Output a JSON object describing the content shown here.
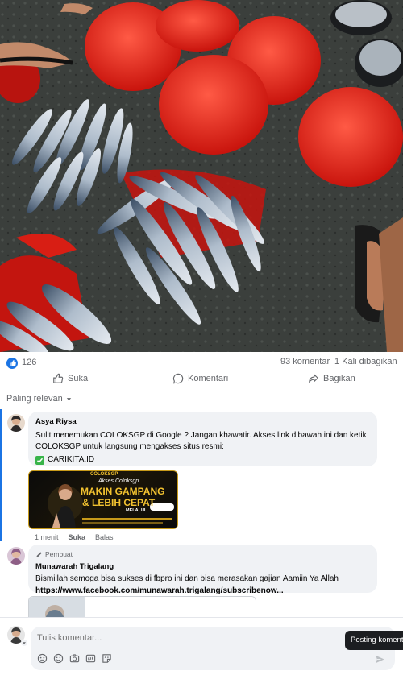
{
  "post": {
    "like_count": "126",
    "comments_count": "93 komentar",
    "shares_count": "1 Kali dibagikan"
  },
  "actions": {
    "like": "Suka",
    "comment": "Komentari",
    "share": "Bagikan"
  },
  "sort": {
    "label": "Paling relevan"
  },
  "comments": [
    {
      "author": "Asya Riysa",
      "text": "Sulit menemukan COLOKSGP di Google ? Jangan khawatir. Akses link dibawah ini dan ketik COLOKSGP untuk langsung mengakses situs resmi:",
      "link_line": "CARIKITA.ID",
      "banner": {
        "brand": "COLOKSGP",
        "line1": "Akses Coloksgp",
        "line2": "MAKIN GAMPANG",
        "line3": "& LEBIH CEPAT",
        "line4": "MELALUI"
      },
      "time": "1 menit",
      "like": "Suka",
      "reply": "Balas"
    },
    {
      "badge": "Pembuat",
      "author": "Munawarah Trigalang",
      "text": "Bismillah semoga bisa sukses di fbpro ini dan bisa merasakan gajian Aamiin Ya Allah",
      "link": "https://www.facebook.com/munawarah.trigalang/subscribenow..."
    }
  ],
  "composer": {
    "placeholder": "Tulis komentar...",
    "tooltip": "Posting komentar"
  },
  "colors": {
    "accent": "#1b74e4",
    "muted": "#65676b",
    "bubble": "#f0f2f5",
    "banner_gold": "#f2c230"
  }
}
